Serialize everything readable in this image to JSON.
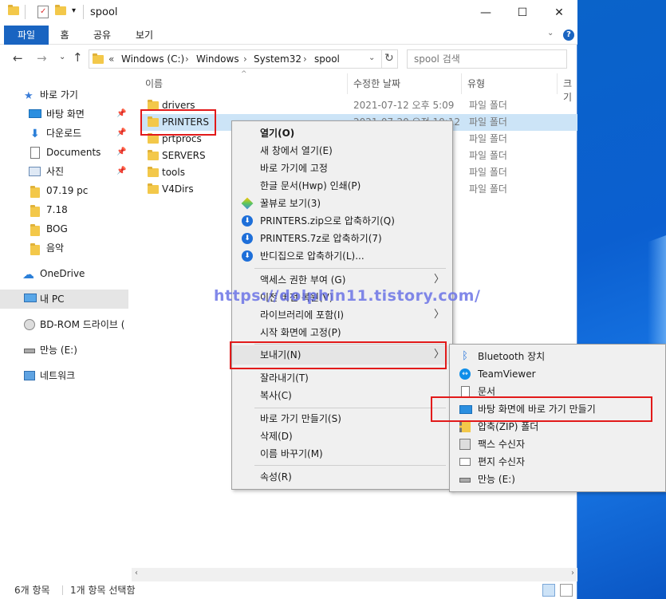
{
  "window": {
    "title": "spool",
    "controls": {
      "minimize": "—",
      "maximize": "☐",
      "close": "✕"
    }
  },
  "ribbon": {
    "tabs": [
      "파일",
      "홈",
      "공유",
      "보기"
    ]
  },
  "address": {
    "path": [
      "«",
      "Windows (C:)",
      "Windows",
      "System32",
      "spool"
    ],
    "search_placeholder": "spool 검색"
  },
  "nav": {
    "items": [
      {
        "label": "바로 가기",
        "icon": "star-icon"
      },
      {
        "label": "바탕 화면",
        "icon": "desktop-icon"
      },
      {
        "label": "다운로드",
        "icon": "download-icon"
      },
      {
        "label": "Documents",
        "icon": "documents-icon"
      },
      {
        "label": "사진",
        "icon": "pictures-icon"
      },
      {
        "label": "07.19 pc",
        "icon": "folder-icon"
      },
      {
        "label": "7.18",
        "icon": "folder-icon"
      },
      {
        "label": "BOG",
        "icon": "folder-icon"
      },
      {
        "label": "음악",
        "icon": "folder-icon"
      },
      {
        "label": "OneDrive",
        "icon": "cloud-icon"
      },
      {
        "label": "내 PC",
        "icon": "pc-icon"
      },
      {
        "label": "BD-ROM 드라이브 (",
        "icon": "disc-icon"
      },
      {
        "label": "만능 (E:)",
        "icon": "drive-icon"
      },
      {
        "label": "네트워크",
        "icon": "network-icon"
      }
    ]
  },
  "files": {
    "headers": [
      "이름",
      "수정한 날짜",
      "유형",
      "크기"
    ],
    "rows": [
      {
        "name": "drivers",
        "date": "2021-07-12 오후 5:09",
        "type": "파일 폴더"
      },
      {
        "name": "PRINTERS",
        "date": "2021-07-20 오전 10:12",
        "type": "파일 폴더"
      },
      {
        "name": "prtprocs",
        "date": "",
        "type": "파일 폴더"
      },
      {
        "name": "SERVERS",
        "date": "",
        "type": "파일 폴더"
      },
      {
        "name": "tools",
        "date": "",
        "type": "파일 폴더"
      },
      {
        "name": "V4Dirs",
        "date": "",
        "type": "파일 폴더"
      }
    ]
  },
  "status": {
    "count": "6개 항목",
    "selected": "1개 항목 선택함"
  },
  "context_menu": {
    "items": [
      "열기(O)",
      "새 창에서 열기(E)",
      "바로 가기에 고정",
      "한글 문서(Hwp) 인쇄(P)",
      "꿀뷰로 보기(3)",
      "PRINTERS.zip으로 압축하기(Q)",
      "PRINTERS.7z로 압축하기(7)",
      "반디집으로 압축하기(L)...",
      "액세스 권한 부여 (G)",
      "이전 버전 복원(V)",
      "라이브러리에 포함(I)",
      "시작 화면에 고정(P)",
      "보내기(N)",
      "잘라내기(T)",
      "복사(C)",
      "바로 가기 만들기(S)",
      "삭제(D)",
      "이름 바꾸기(M)",
      "속성(R)"
    ]
  },
  "sendto_menu": {
    "items": [
      "Bluetooth 장치",
      "TeamViewer",
      "문서",
      "바탕 화면에 바로 가기 만들기",
      "압축(ZIP) 폴더",
      "팩스 수신자",
      "편지 수신자",
      "만능 (E:)"
    ]
  },
  "watermark": "https://dolphin11.tistory.com/",
  "colors": {
    "accent": "#1964c1",
    "selection": "#cce4f7",
    "highlight_box": "#e21a1a"
  }
}
